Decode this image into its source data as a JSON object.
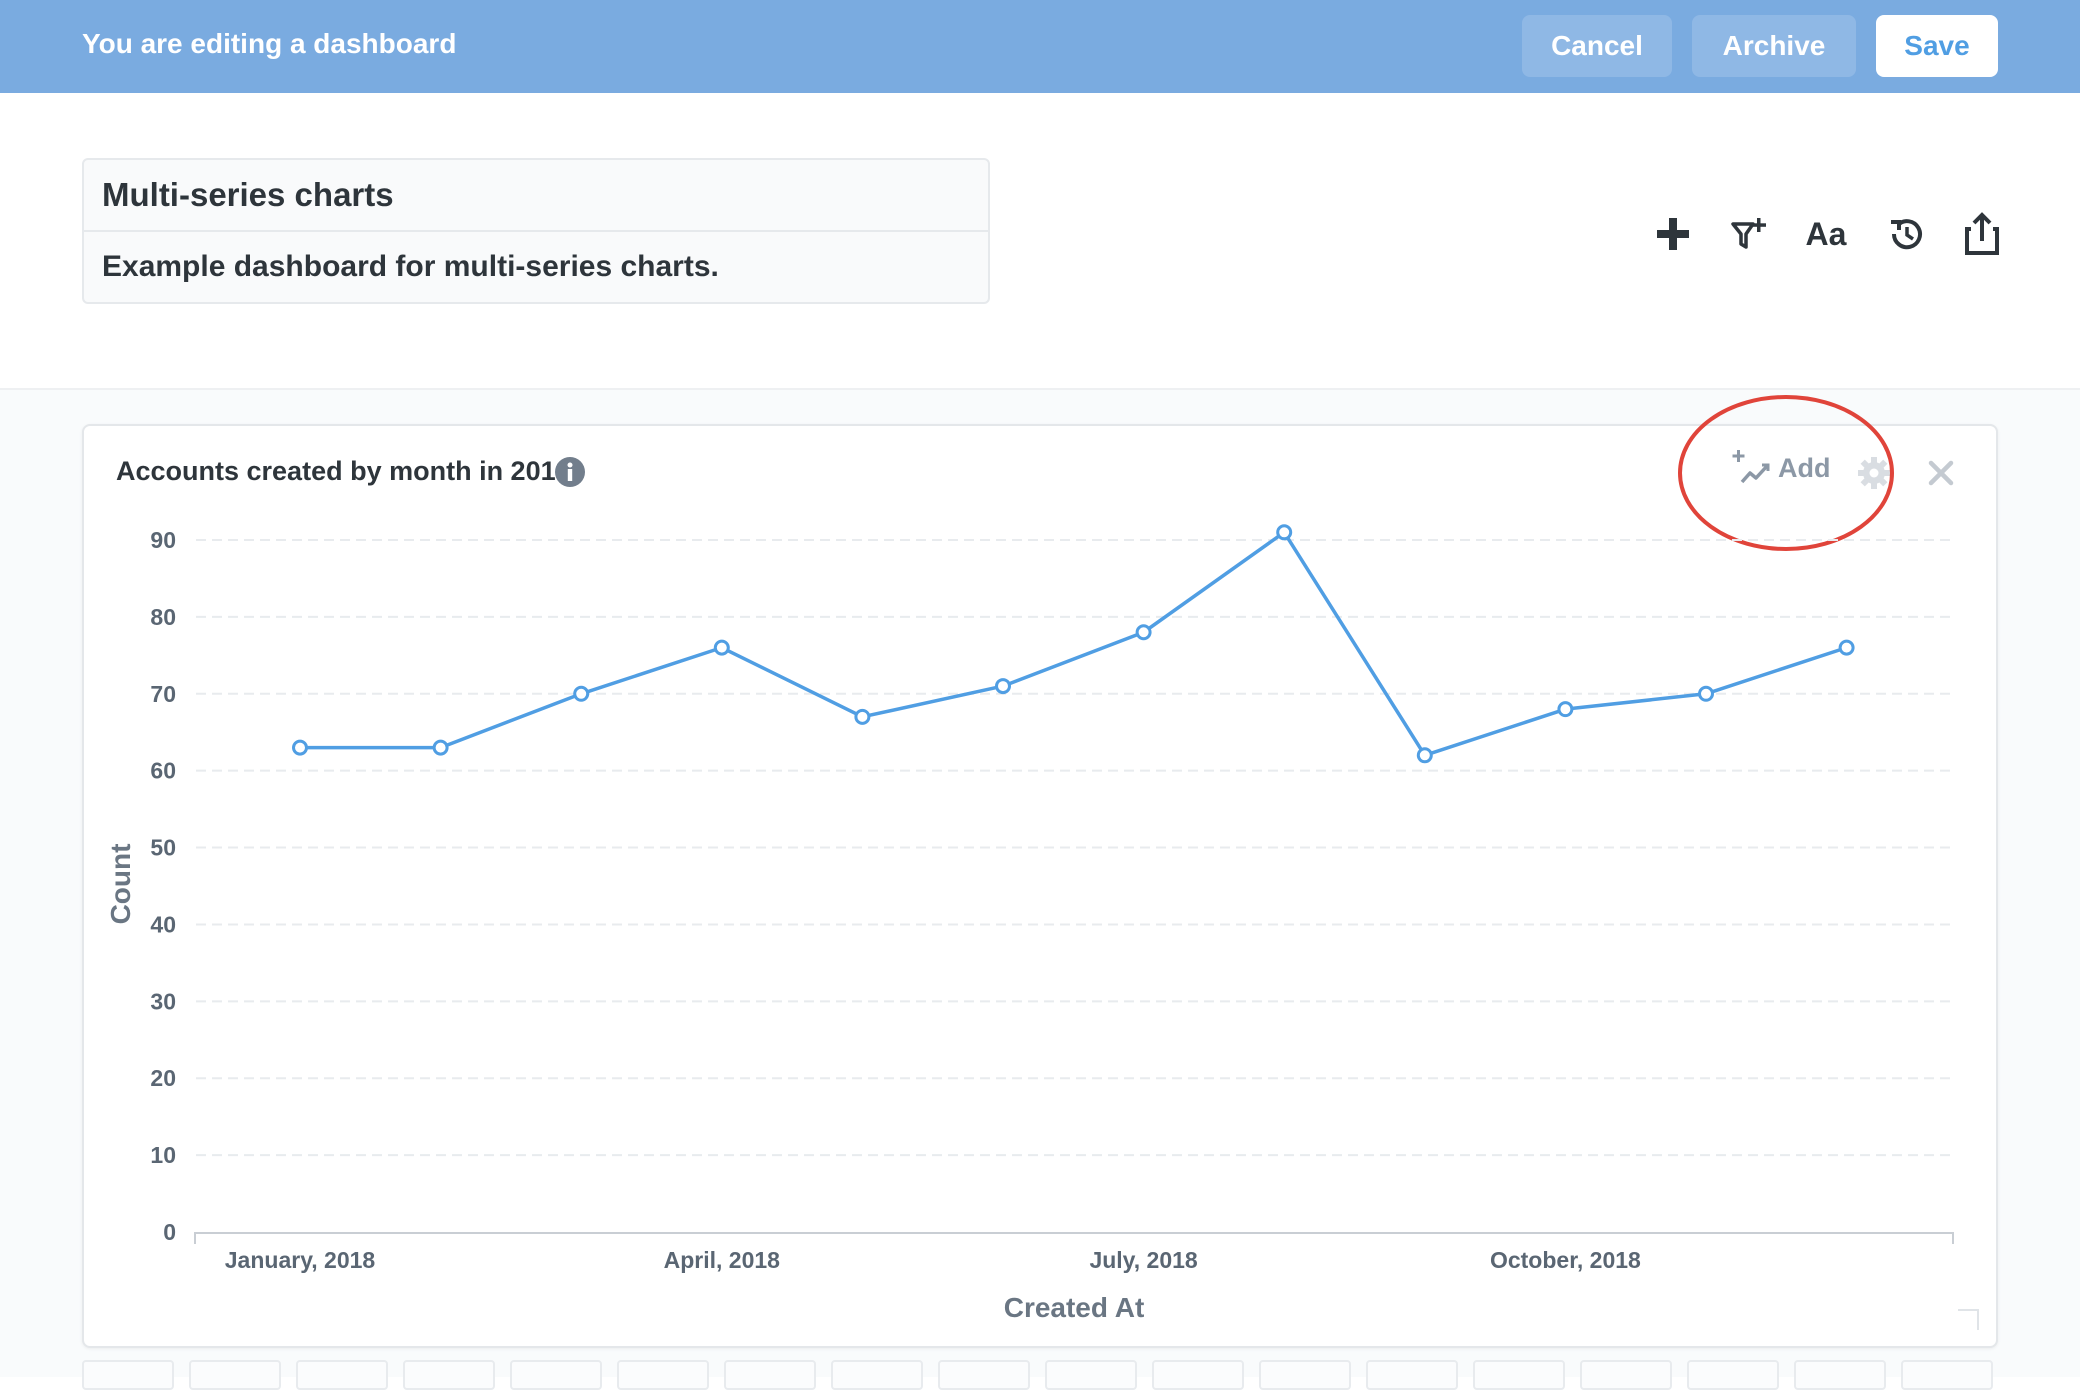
{
  "edit_bar": {
    "title": "You are editing a dashboard",
    "cancel_label": "Cancel",
    "archive_label": "Archive",
    "save_label": "Save"
  },
  "dashboard": {
    "name": "Multi-series charts",
    "description": "Example dashboard for multi-series charts."
  },
  "toolbar": {
    "icons": [
      "plus-icon",
      "filter-add-icon",
      "text-icon",
      "history-icon",
      "share-icon"
    ],
    "text_icon_label": "Aa"
  },
  "card": {
    "title": "Accounts created by month in 2018",
    "add_label": "Add",
    "icons": [
      "info-icon",
      "add-series-icon",
      "gear-icon",
      "close-icon"
    ]
  },
  "colors": {
    "edit_bar": "#7aabe0",
    "series": "#509ee3",
    "highlight_circle": "#e0443a"
  },
  "chart_data": {
    "type": "line",
    "xlabel": "Created At",
    "ylabel": "Count",
    "ylim": [
      0,
      90
    ],
    "yticks": [
      "0",
      "10",
      "20",
      "30",
      "40",
      "50",
      "60",
      "70",
      "80",
      "90"
    ],
    "x": [
      "January, 2018",
      "February, 2018",
      "March, 2018",
      "April, 2018",
      "May, 2018",
      "June, 2018",
      "July, 2018",
      "August, 2018",
      "September, 2018",
      "October, 2018",
      "November, 2018",
      "December, 2018"
    ],
    "xtick_labels": [
      "January, 2018",
      "April, 2018",
      "July, 2018",
      "October, 2018"
    ],
    "values": [
      63,
      63,
      70,
      76,
      67,
      71,
      78,
      91,
      62,
      68,
      70,
      76
    ],
    "grid": "horizontal dashed"
  }
}
